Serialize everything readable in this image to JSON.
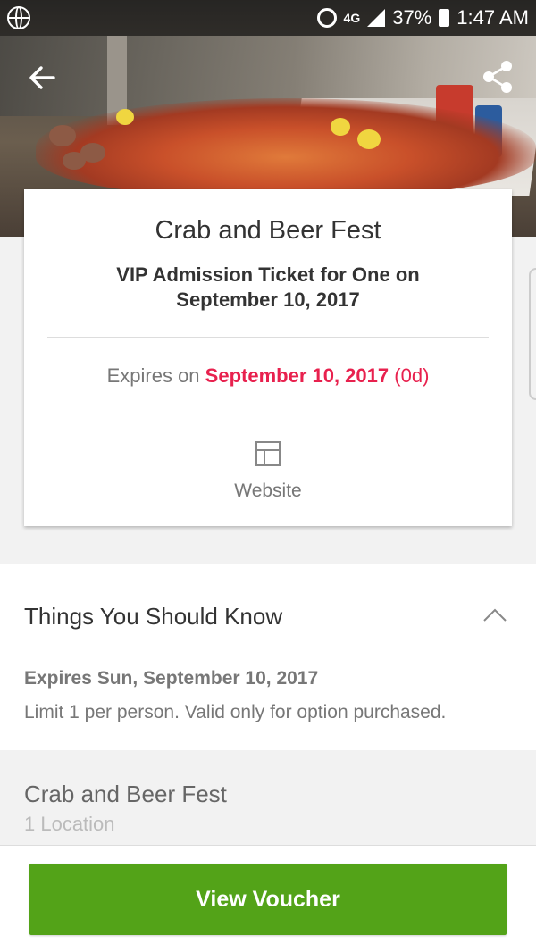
{
  "status_bar": {
    "network": "4G",
    "battery": "37%",
    "time": "1:47 AM"
  },
  "deal": {
    "title": "Crab and Beer Fest",
    "subtitle": "VIP Admission Ticket for One on September 10, 2017",
    "expires_prefix": "Expires on",
    "expires_date": "September 10, 2017",
    "expires_days": "(0d)",
    "website_label": "Website"
  },
  "know": {
    "heading": "Things You Should Know",
    "expires_line": "Expires Sun, September 10, 2017",
    "limit_line": "Limit 1 per person. Valid only for option purchased."
  },
  "location": {
    "name": "Crab and Beer Fest",
    "count": "1 Location"
  },
  "actions": {
    "view_voucher_label": "View Voucher"
  },
  "colors": {
    "accent_red": "#e8214e",
    "button_green": "#53a318"
  },
  "icons": [
    "globe-icon",
    "alarm-icon",
    "signal-icon",
    "battery-icon",
    "back-arrow-icon",
    "share-icon",
    "website-icon",
    "chevron-up-icon"
  ]
}
